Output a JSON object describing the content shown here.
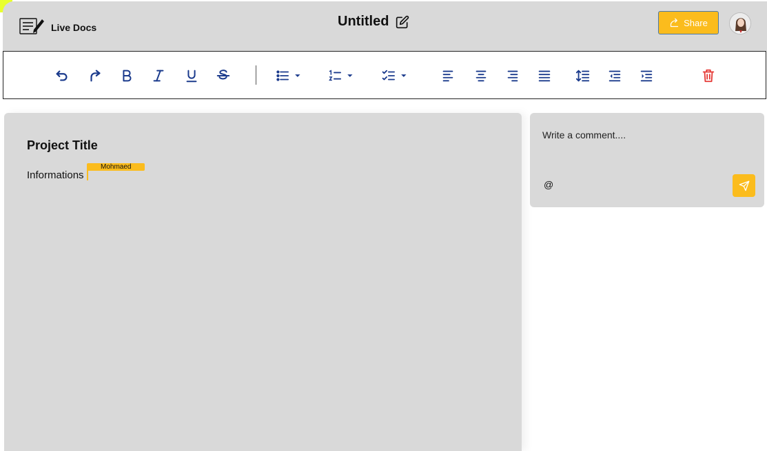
{
  "app": {
    "name": "Live Docs",
    "logo_icon": "notepad-pencil-icon"
  },
  "document": {
    "title": "Untitled",
    "edit_icon": "edit-pencil-icon"
  },
  "header": {
    "share_label": "Share",
    "share_icon": "share-icon",
    "accent_color": "#fbbc1d"
  },
  "toolbar": {
    "items": [
      {
        "icon": "undo-icon"
      },
      {
        "icon": "redo-icon"
      },
      {
        "icon": "bold-icon"
      },
      {
        "icon": "italic-icon"
      },
      {
        "icon": "underline-icon"
      },
      {
        "icon": "strikethrough-icon"
      },
      {
        "icon": "bullet-list-icon"
      },
      {
        "icon": "numbered-list-icon"
      },
      {
        "icon": "checklist-icon"
      },
      {
        "icon": "align-left-icon"
      },
      {
        "icon": "align-center-icon"
      },
      {
        "icon": "align-right-icon"
      },
      {
        "icon": "align-justify-icon"
      },
      {
        "icon": "line-height-icon"
      },
      {
        "icon": "outdent-icon"
      },
      {
        "icon": "indent-icon"
      },
      {
        "icon": "trash-icon"
      }
    ],
    "icon_color": "#1a3a8c",
    "delete_color": "#e53935"
  },
  "editor": {
    "heading": "Project Title",
    "paragraph": "Informations",
    "collaborator_cursor": {
      "name": "Mohmaed",
      "color": "#fbbc1d"
    }
  },
  "comments": {
    "placeholder": "Write a comment....",
    "mention_label": "@",
    "send_icon": "send-icon"
  }
}
